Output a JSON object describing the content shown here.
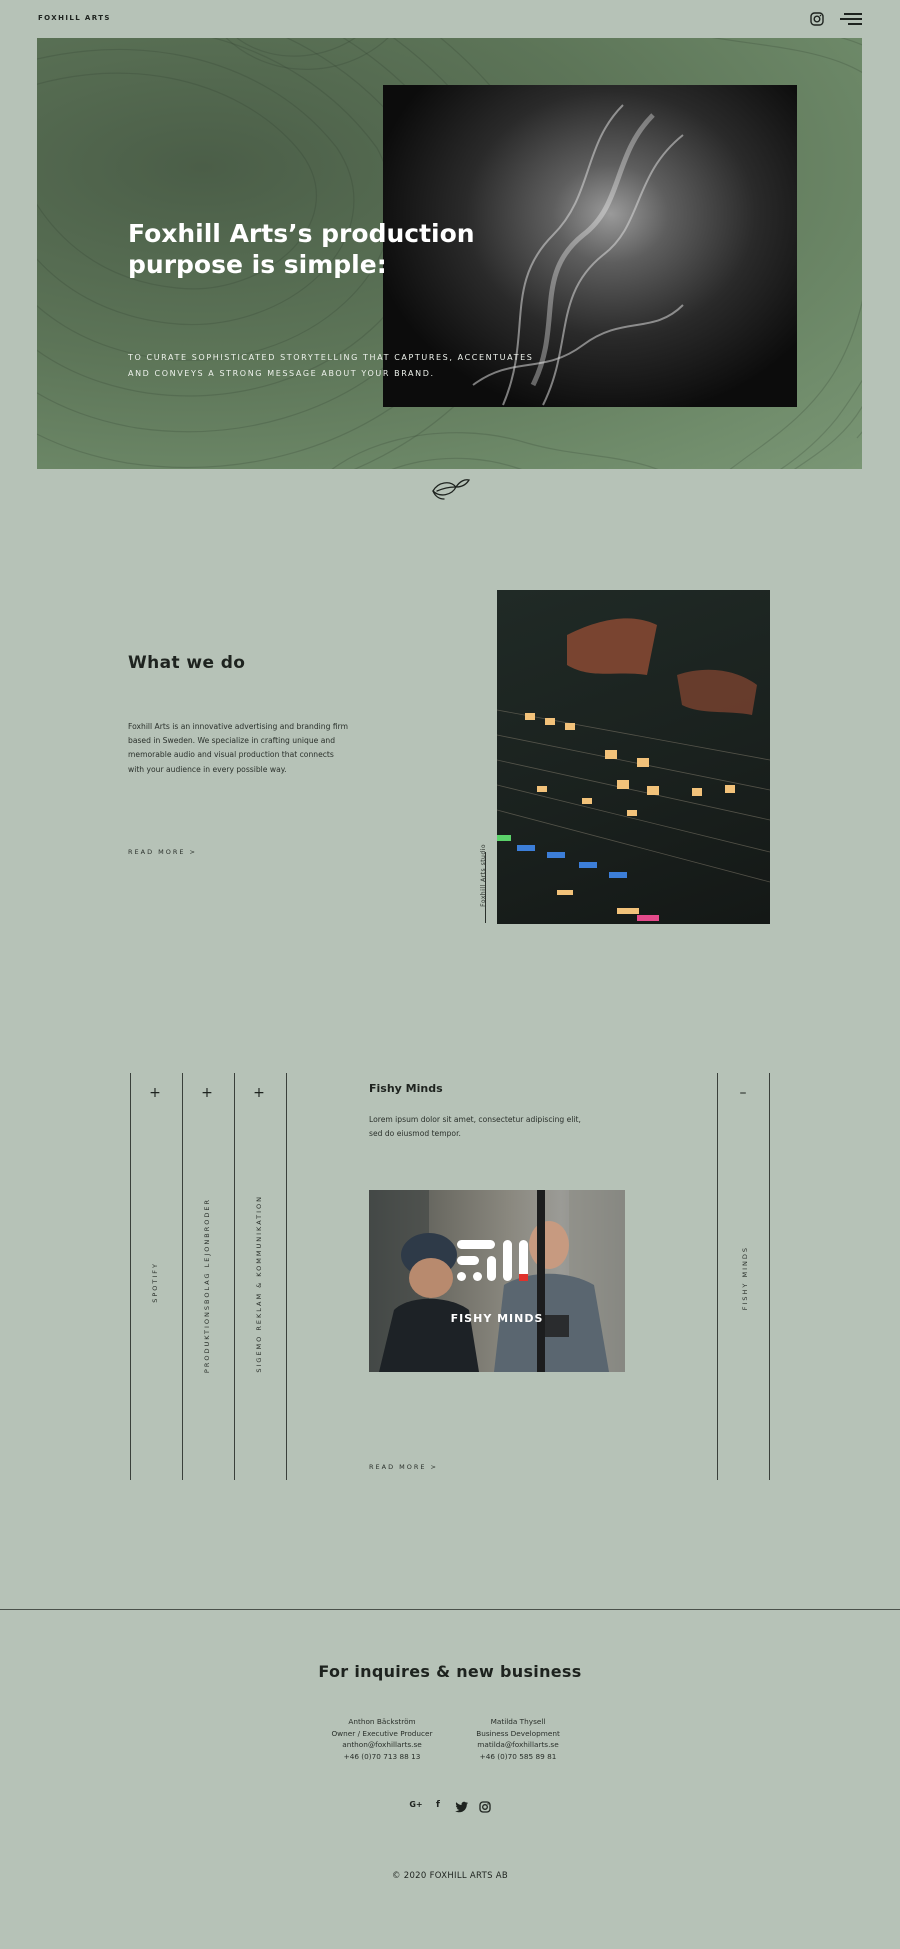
{
  "header": {
    "brand": "FOXHILL ARTS",
    "instagram_icon": "instagram-icon",
    "menu_icon": "hamburger-menu-icon"
  },
  "hero": {
    "title": "Foxhill Arts’s production purpose is simple:",
    "subtitle": "TO CURATE SOPHISTICATED STORYTELLING THAT CAPTURES, ACCENTUATES AND CONVEYS A STRONG MESSAGE ABOUT YOUR BRAND.",
    "divider_icon": "fox-leaf-logo-icon"
  },
  "what_we_do": {
    "title": "What we do",
    "text": "Foxhill Arts is an innovative advertising and branding firm based in Sweden. We specialize in crafting unique and memorable audio and visual production that connects with your audience in every possible way.",
    "read_more": "READ MORE  >",
    "image_label": "Foxhill Arts studio"
  },
  "projects": {
    "tabs": [
      {
        "label": "SPOTIFY",
        "toggle": "+"
      },
      {
        "label": "PRODUKTIONSBOLAG LEJONBRODER",
        "toggle": "+"
      },
      {
        "label": "SIGEMO REKLAM & KOMMUNIKATION",
        "toggle": "+"
      }
    ],
    "active": {
      "title": "Fishy Minds",
      "text": "Lorem ipsum dolor sit amet, consectetur adipiscing elit, sed do eiusmod tempor.",
      "logo_text": "FISHY MINDS",
      "read_more": "READ MORE  >",
      "side_label": "FISHY MINDS",
      "toggle": "–"
    }
  },
  "footer": {
    "title": "For inquires & new business",
    "contacts": [
      {
        "name": "Anthon Bäckström",
        "role": "Owner / Executive Producer",
        "email": "anthon@foxhillarts.se",
        "phone": "+46 (0)70 713 88 13"
      },
      {
        "name": "Matilda Thysell",
        "role": "Business Development",
        "email": "matilda@foxhillarts.se",
        "phone": "+46 (0)70 585 89 81"
      }
    ],
    "social": [
      {
        "icon": "google-plus-icon",
        "glyph": "G+"
      },
      {
        "icon": "facebook-icon",
        "glyph": "f"
      },
      {
        "icon": "twitter-icon",
        "glyph": ""
      },
      {
        "icon": "instagram-icon",
        "glyph": ""
      }
    ],
    "copyright": "© 2020 FOXHILL ARTS AB"
  },
  "colors": {
    "background": "#b6c2b7",
    "hero_green": "#6f8b6a",
    "text": "#1e231f",
    "accent_red": "#e0322c"
  }
}
